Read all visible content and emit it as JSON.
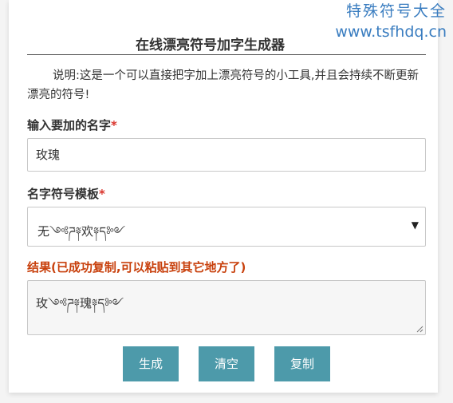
{
  "watermark": {
    "title": "特殊符号大全",
    "url": "www.tsfhdq.cn"
  },
  "page": {
    "title": "在线漂亮符号加字生成器",
    "description": "说明:这是一个可以直接把字加上漂亮符号的小工具,并且会持续不断更新漂亮的符号!"
  },
  "form": {
    "name_label": "输入要加的名字",
    "required_mark": "*",
    "name_value": "玫瑰",
    "template_label": "名字符号模板",
    "template_value": "无༺ཌ༈欢༈ད༻",
    "template_arrow": "▼",
    "result_label": "结果(已成功复制,可以粘贴到其它地方了)",
    "result_value": "玫༺ཌ༈瑰༈ད༻"
  },
  "buttons": {
    "generate": "生成",
    "clear": "清空",
    "copy": "复制"
  },
  "colors": {
    "button_bg": "#4d9aaa",
    "result_label": "#c8400c",
    "required": "#d9332b",
    "watermark": "#3a7dc0"
  }
}
